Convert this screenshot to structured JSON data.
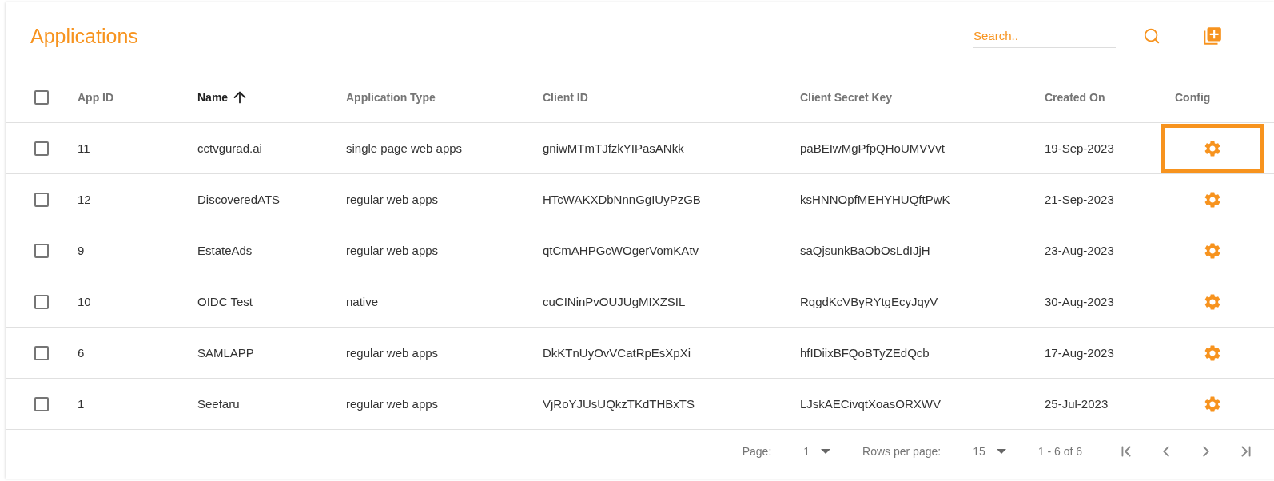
{
  "title": "Applications",
  "search": {
    "placeholder": "Search.."
  },
  "table": {
    "columns": [
      {
        "label": "App ID",
        "sorted": false
      },
      {
        "label": "Name",
        "sorted": true
      },
      {
        "label": "Application Type",
        "sorted": false
      },
      {
        "label": "Client ID",
        "sorted": false
      },
      {
        "label": "Client Secret Key",
        "sorted": false
      },
      {
        "label": "Created On",
        "sorted": false
      },
      {
        "label": "Config",
        "sorted": false
      }
    ],
    "all_checked": false,
    "rows": [
      {
        "checked": false,
        "highlighted": true,
        "cells": [
          "11",
          "cctvgurad.ai",
          "single page web apps",
          "gniwMTmTJfzkYIPasANkk",
          "paBEIwMgPfpQHoUMVVvt",
          "19-Sep-2023"
        ]
      },
      {
        "checked": false,
        "highlighted": false,
        "cells": [
          "12",
          "DiscoveredATS",
          "regular web apps",
          "HTcWAKXDbNnnGgIUyPzGB",
          "ksHNNOpfMEHYHUQftPwK",
          "21-Sep-2023"
        ]
      },
      {
        "checked": false,
        "highlighted": false,
        "cells": [
          "9",
          "EstateAds",
          "regular web apps",
          "qtCmAHPGcWOgerVomKAtv",
          "saQjsunkBaObOsLdIJjH",
          "23-Aug-2023"
        ]
      },
      {
        "checked": false,
        "highlighted": false,
        "cells": [
          "10",
          "OIDC Test",
          "native",
          "cuCINinPvOUJUgMIXZSIL",
          "RqgdKcVByRYtgEcyJqyV",
          "30-Aug-2023"
        ]
      },
      {
        "checked": false,
        "highlighted": false,
        "cells": [
          "6",
          "SAMLAPP",
          "regular web apps",
          "DkKTnUyOvVCatRpEsXpXi",
          "hfIDiixBFQoBTyZEdQcb",
          "17-Aug-2023"
        ]
      },
      {
        "checked": false,
        "highlighted": false,
        "cells": [
          "1",
          "Seefaru",
          "regular web apps",
          "VjRoYJUsUQkzTKdTHBxTS",
          "LJskAECivqtXoasORXWV",
          "25-Jul-2023"
        ]
      }
    ]
  },
  "pagination": {
    "page_label": "Page:",
    "page": "1",
    "rows_label": "Rows per page:",
    "rows_per_page": "15",
    "range": "1 - 6 of 6"
  }
}
